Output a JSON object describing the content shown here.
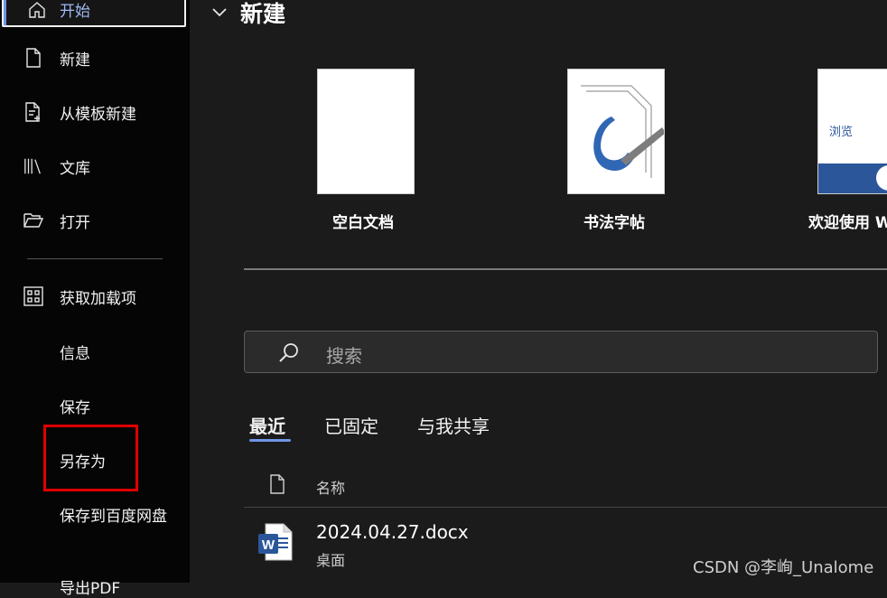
{
  "sidebar": {
    "home_label": "开始",
    "items": [
      {
        "label": "新建",
        "icon": "new-document-icon"
      },
      {
        "label": "从模板新建",
        "icon": "template-document-icon"
      },
      {
        "label": "文库",
        "icon": "library-icon"
      },
      {
        "label": "打开",
        "icon": "folder-open-icon"
      },
      {
        "label": "获取加载项",
        "icon": "addins-grid-icon"
      }
    ],
    "sub_items": [
      "信息",
      "保存",
      "另存为",
      "保存到百度网盘",
      "导出PDF"
    ]
  },
  "main": {
    "section_title": "新建",
    "templates": [
      {
        "label": "空白文档"
      },
      {
        "label": "书法字帖"
      },
      {
        "label": "欢迎使用 W",
        "thumb_text": "浏览"
      }
    ],
    "search_placeholder": "搜索",
    "tabs": [
      "最近",
      "已固定",
      "与我共享"
    ],
    "column_name": "名称",
    "files": [
      {
        "name": "2024.04.27.docx",
        "location": "桌面"
      }
    ]
  },
  "colors": {
    "accent": "#6f94e8",
    "highlight": "#e00000",
    "word_blue": "#2b579a"
  },
  "watermark": "CSDN @李峋_Unalome"
}
